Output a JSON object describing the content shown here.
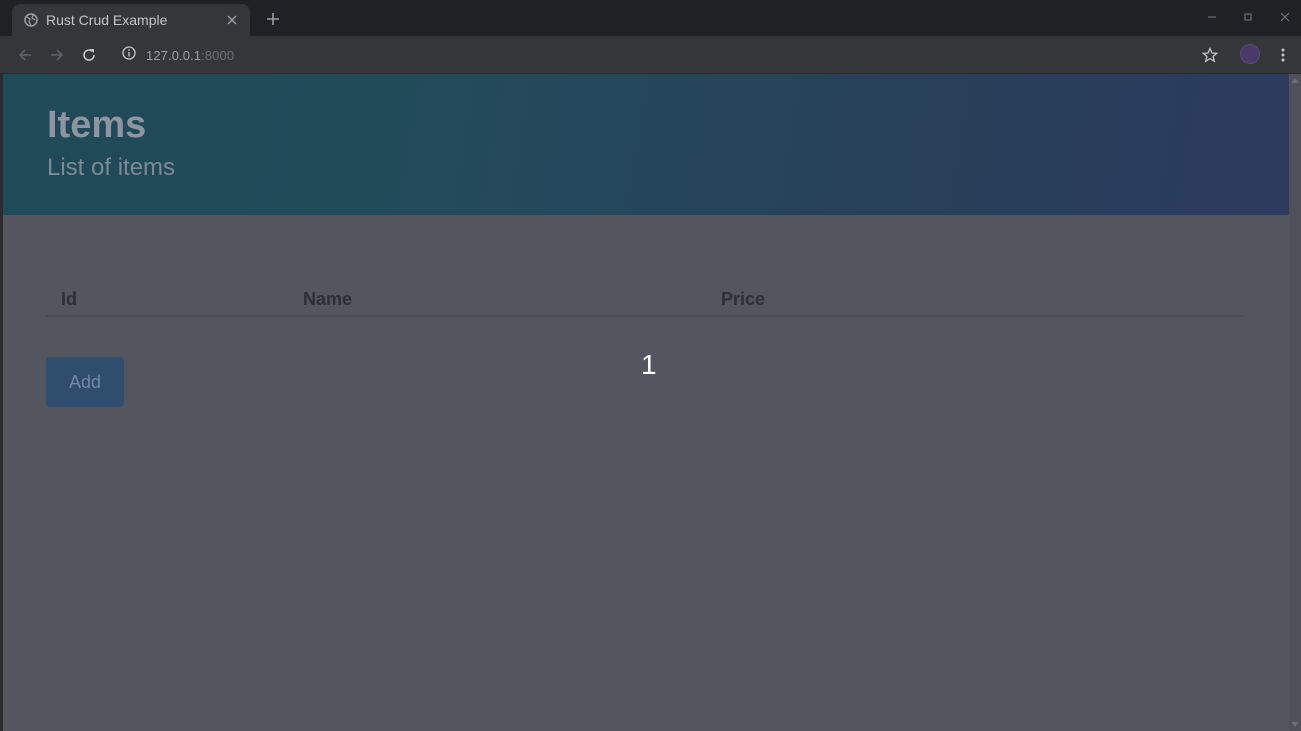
{
  "browser": {
    "tab": {
      "title": "Rust Crud Example"
    },
    "address_bar": {
      "host": "127.0.0.1",
      "port": ":8000"
    }
  },
  "page": {
    "header": {
      "title": "Items",
      "subtitle": "List of items"
    },
    "table": {
      "columns": [
        "Id",
        "Name",
        "Price"
      ],
      "rows": []
    },
    "add_button_label": "Add",
    "overlay_number": "1"
  },
  "colors": {
    "page_background": "#53565f",
    "header_gradient_start": "#1f4a57",
    "header_gradient_end": "#2c3b5e",
    "add_button": "#2f4e6e",
    "browser_frame": "#202124"
  }
}
